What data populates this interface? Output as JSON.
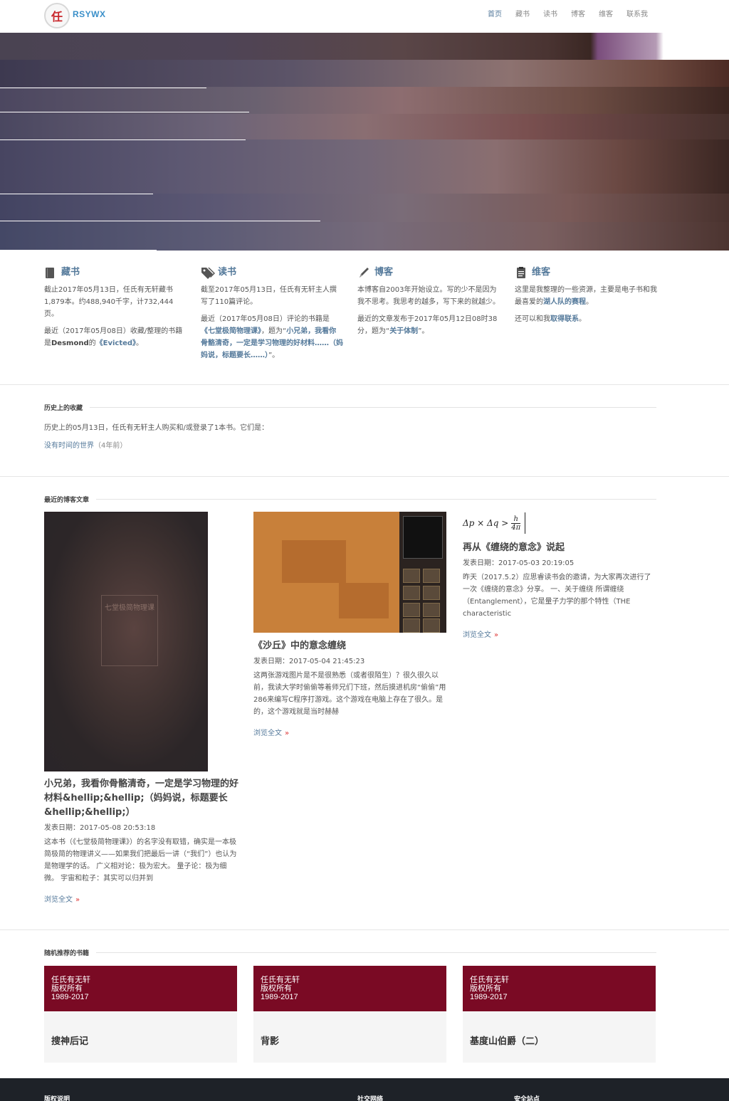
{
  "header": {
    "logo_char": "任",
    "logo_text": "RSYWX",
    "nav": [
      "首页",
      "藏书",
      "读书",
      "博客",
      "维客",
      "联系我"
    ]
  },
  "features": [
    {
      "icon": "book-icon",
      "title": "藏书",
      "p1": "截止2017年05月13日，任氏有无轩藏书1,879本。约488,940千字，计732,444页。",
      "p2_prefix": "最近（2017年05月08日）收藏/整理的书籍是",
      "p2_bold": "Desmond",
      "p2_mid": "的",
      "p2_link": "《Evicted》",
      "p2_suffix": "。"
    },
    {
      "icon": "tags-icon",
      "title": "读书",
      "p1": "截至2017年05月13日，任氏有无轩主人撰写了110篇评论。",
      "p2_prefix": "最近（2017年05月08日）评论的书籍是",
      "p2_link1": "《七堂极简物理课》",
      "p2_mid": "，题为“",
      "p2_link2": "小兄弟，我看你骨骼清奇，一定是学习物理的好材料……（妈妈说，标题要长……）",
      "p2_suffix": "”。"
    },
    {
      "icon": "pencil-icon",
      "title": "博客",
      "p1": "本博客自2003年开始设立。写的少不是因为我不思考。我思考的越多，写下来的就越少。",
      "p2_prefix": "最近的文章发布于2017年05月12日08时38分，题为“",
      "p2_link": "关于体制",
      "p2_suffix": "”。"
    },
    {
      "icon": "clipboard-icon",
      "title": "维客",
      "p1_prefix": "这里是我整理的一些资源，主要是电子书和我最喜爱的",
      "p1_link": "湖人队的赛程",
      "p1_suffix": "。",
      "p2_prefix": "还可以和我",
      "p2_link": "取得联系",
      "p2_suffix": "。"
    }
  ],
  "history": {
    "title": "历史上的收藏",
    "text": "历史上的05月13日，任氏有无轩主人购买和/或登录了1本书。它们是：",
    "link": "没有时间的世界",
    "ago": "（4年前）"
  },
  "blog": {
    "title": "最近的博客文章",
    "book_cover_title": "七堂极简物理课",
    "posts": [
      {
        "title": "小兄弟，我看你骨骼清奇，一定是学习物理的好材料&hellip;&hellip;（妈妈说，标题要长&hellip;&hellip;）",
        "date": "发表日期：2017-05-08 20:53:18",
        "excerpt": "这本书（《七堂极简物理课》）的名字没有取错，确实是一本极简极简的物理讲义——如果我们把最后一讲（“我们”）也认为是物理学的话。 广义相对论：极为宏大。 量子论：极为细微。 宇宙和粒子：其实可以归并到",
        "more": "浏览全文",
        "raquo": "»"
      },
      {
        "title": "《沙丘》中的意念缠绕",
        "date": "发表日期：2017-05-04 21:45:23",
        "excerpt": "这两张游戏图片是不是很熟悉（或者很陌生）？很久很久以前，我读大学时偷偷等着师兄们下班，然后摸进机房“偷偷”用286来编写C程序打游戏。这个游戏在电脑上存在了很久。是的，这个游戏就是当时赫赫",
        "more": "浏览全文",
        "raquo": "»"
      },
      {
        "title": "再从《缠绕的意念》说起",
        "date": "发表日期：2017-05-03 20:19:05",
        "excerpt": "昨天（2017.5.2）应思睿读书会的邀请，为大家再次进行了一次《缠绕的意念》分享。 一、关于缠绕 所谓缠绕（Entanglement），它是量子力学的那个特性（THE characteristic",
        "more": "浏览全文",
        "raquo": "»",
        "formula_lhs": "Δp × Δq >",
        "formula_num": "h",
        "formula_den": "4π"
      }
    ]
  },
  "recommend": {
    "title": "随机推荐的书籍",
    "cover_line1": "任氏有无轩",
    "cover_line2": "版权所有",
    "cover_line3": "1989-2017",
    "books": [
      "搜神后记",
      "背影",
      "基度山伯爵（二）"
    ]
  },
  "footer": {
    "cols": [
      "版权说明",
      "社交网络",
      "安全站点"
    ]
  },
  "colors": {
    "accent": "#557a9b",
    "cover": "#7a0a24",
    "footer": "#1e2228"
  }
}
